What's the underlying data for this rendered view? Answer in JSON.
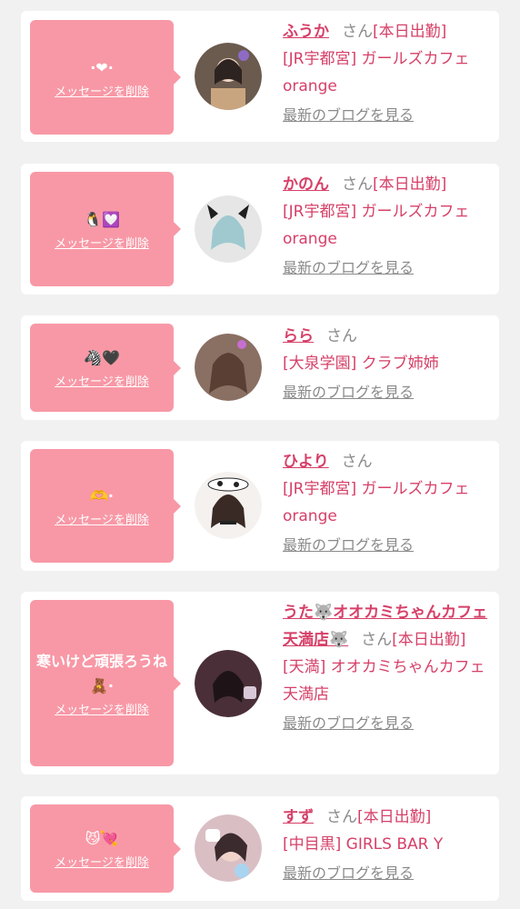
{
  "delete_label": "メッセージを削除",
  "blog_label": "最新のブログを見る",
  "san_label": "さん",
  "colors": {
    "bubble": "#f898a6",
    "accent": "#d64068",
    "muted": "#8a8a8a",
    "background": "#f1f1f1"
  },
  "entries": [
    {
      "message": "·❤·",
      "name": "ふうか",
      "status": "[本日出勤]",
      "shop": "[JR宇都宮] ガールズカフェ orange"
    },
    {
      "message": "🐧💟",
      "name": "かのん",
      "status": "[本日出勤]",
      "shop": "[JR宇都宮] ガールズカフェ orange"
    },
    {
      "message": "🦓🖤",
      "name": "らら",
      "status": "",
      "shop": "[大泉学園] クラブ姉姉"
    },
    {
      "message": "🫶·",
      "name": "ひより",
      "status": "",
      "shop": "[JR宇都宮] ガールズカフェ orange"
    },
    {
      "message": "寒いけど頑張ろうね🧸·",
      "name": "うた🐺オオカミちゃんカフェ天満店🐺",
      "status": "[本日出勤]",
      "shop": "[天満] オオカミちゃんカフェ天満店"
    },
    {
      "message": "😼💘",
      "name": "すず",
      "status": "[本日出勤]",
      "shop": "[中目黒] GIRLS BAR Y"
    }
  ]
}
